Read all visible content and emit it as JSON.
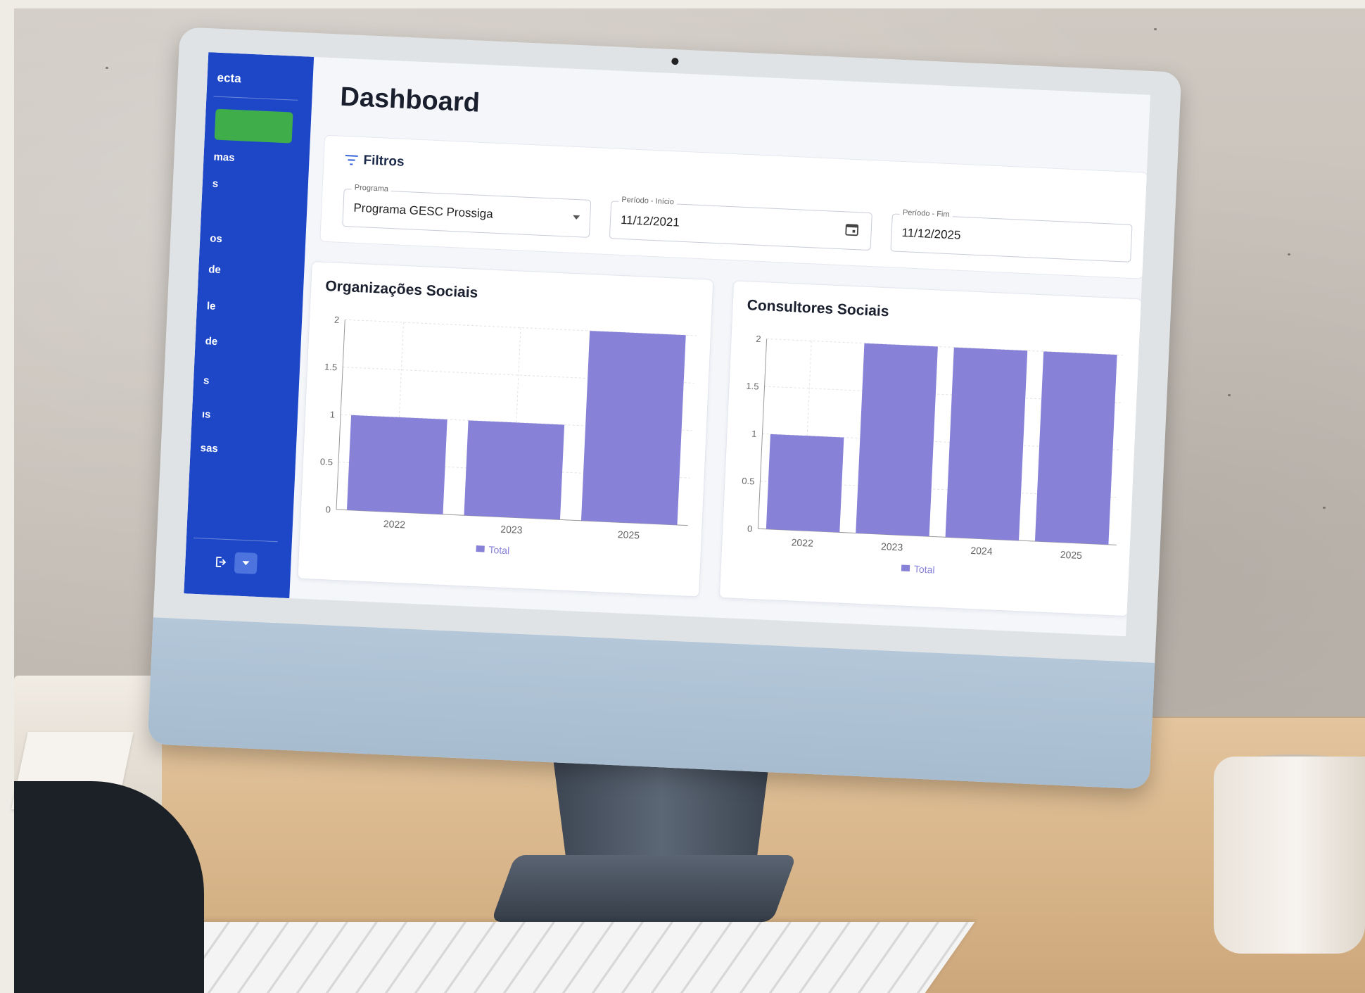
{
  "sidebar": {
    "brand": "ecta",
    "items": [
      "mas",
      "s",
      "os",
      "de",
      "le",
      "de",
      "s",
      "ıs",
      "sas"
    ]
  },
  "main": {
    "title": "Dashboard",
    "filters": {
      "heading": "Filtros",
      "program": {
        "label": "Programa",
        "value": "Programa GESC Prossiga"
      },
      "start": {
        "label": "Período - Início",
        "value": "11/12/2021"
      },
      "end": {
        "label": "Período - Fim",
        "value": "11/12/2025"
      }
    }
  },
  "colors": {
    "sidebar": "#1d47c7",
    "active_nav": "#3fae4a",
    "bar": "#8781d8"
  },
  "icons": [
    "filter-icon",
    "calendar-icon",
    "logout-icon",
    "chevron-down-icon"
  ],
  "chart_data": [
    {
      "type": "bar",
      "title": "Organizações Sociais",
      "categories": [
        "2022",
        "2023",
        "2025"
      ],
      "series": [
        {
          "name": "Total",
          "values": [
            1,
            1,
            2
          ]
        }
      ],
      "ylim": [
        0,
        2
      ],
      "yticks": [
        "0",
        "0.5",
        "1",
        "1.5",
        "2"
      ],
      "grid": true,
      "legend": "bottom"
    },
    {
      "type": "bar",
      "title": "Consultores Sociais",
      "categories": [
        "2022",
        "2023",
        "2024",
        "2025"
      ],
      "series": [
        {
          "name": "Total",
          "values": [
            1,
            2,
            2,
            2
          ]
        }
      ],
      "ylim": [
        0,
        2
      ],
      "yticks": [
        "0",
        "0.5",
        "1",
        "1.5",
        "2"
      ],
      "grid": true,
      "legend": "bottom"
    }
  ]
}
